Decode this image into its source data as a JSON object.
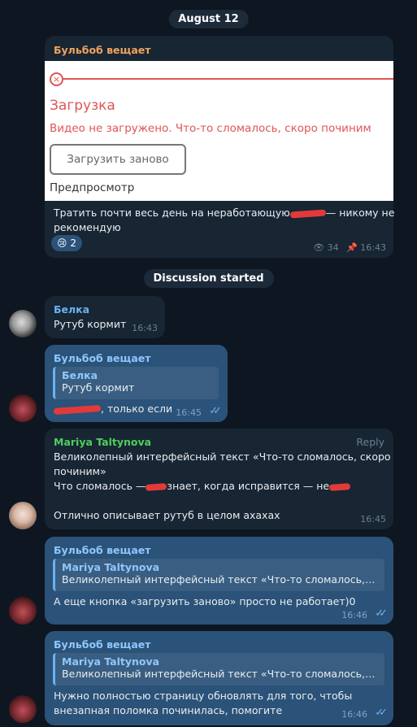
{
  "date_pill": "August 12",
  "discussion_pill": "Discussion started",
  "channel_post": {
    "sender": "Бульбоб вещает",
    "preview": {
      "title": "Загрузка",
      "error": "Видео не загружено. Что-то сломалось, скоро починим",
      "reload_button": "Загрузить заново",
      "preview_label": "Предпросмотр"
    },
    "text_line1": "Тратить почти весь день на неработающую",
    "text_line1_end": "— никому не",
    "text_line2": "рекомендую",
    "reaction_emoji": "😢",
    "reaction_count": "2",
    "views": "34",
    "time": "16:43"
  },
  "messages": [
    {
      "sender": "Белка",
      "text": "Рутуб кормит",
      "time": "16:43"
    },
    {
      "sender": "Бульбоб вещает",
      "quote_name": "Белка",
      "quote_text": "Рутуб кормит",
      "text": ", только если",
      "time": "16:45"
    },
    {
      "sender": "Mariya Taltynova",
      "reply_label": "Reply",
      "line1": "Великолепный интерфейсный текст «Что-то сломалось, скоро",
      "line2": "починим»",
      "line3a": "Что сломалось —",
      "line3b": "знает, когда исправится — не",
      "line4": "Отлично описывает рутуб в целом ахахах",
      "time": "16:45"
    },
    {
      "sender": "Бульбоб вещает",
      "quote_name": "Mariya Taltynova",
      "quote_text": "Великолепный интерфейсный текст «Что-то сломалось, скор...",
      "text": "А еще кнопка «загрузить заново» просто не работает)0",
      "time": "16:46"
    },
    {
      "sender": "Бульбоб вещает",
      "quote_name": "Mariya Taltynova",
      "quote_text": "Великолепный интерфейсный текст «Что-то сломалось, скор...",
      "line1": "Нужно полностью страницу обновлять для того, чтобы",
      "line2": "внезапная поломка починилась, помогите",
      "time": "16:46"
    }
  ],
  "colors": {
    "background": "#0e1621",
    "incoming": "#182533",
    "outgoing": "#2b5278",
    "channel_name": "#f0a35e",
    "link_name": "#6ab3f3",
    "mariya_name": "#4fce5d"
  }
}
